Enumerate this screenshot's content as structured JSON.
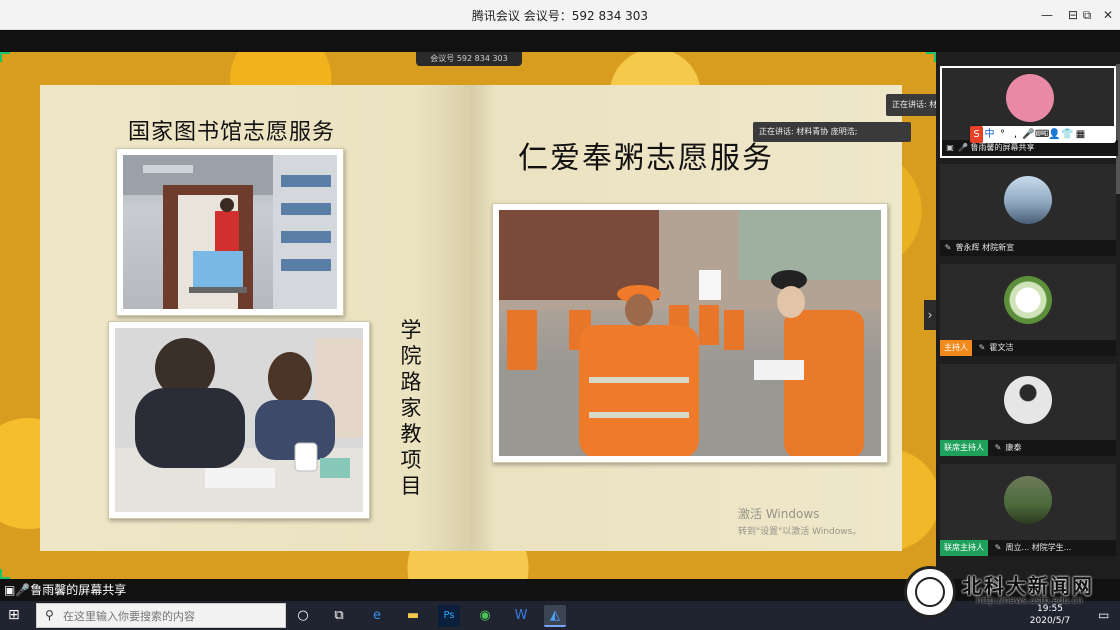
{
  "window": {
    "title": "腾讯会议 会议号：592 834 303",
    "minimize_glyph": "—",
    "maximize_glyph": "⧉",
    "close_glyph": "✕",
    "pin_glyph": "⊟"
  },
  "share": {
    "meeting_badge": "会议号 592 834 303",
    "left_title": "国家图书馆志愿服务",
    "right_title": "仁爱奉粥志愿服务",
    "vertical_text": "学院路家教项目",
    "watermark_line1": "激活 Windows",
    "watermark_line2": "转到\"设置\"以激活 Windows。",
    "nav_arrow": "›"
  },
  "speaking": {
    "tip1": "正在讲话: 材料青协 庞明浩;",
    "tip2": "正在讲话: 材料青协 庞明浩;"
  },
  "ime": {
    "items": [
      "S",
      "中",
      "°",
      ",",
      "🎤",
      "⌨",
      "👤",
      "👕",
      "▦"
    ]
  },
  "participants": [
    {
      "name": "鲁雨馨的屏幕共享",
      "role": ""
    },
    {
      "name": "曾永辉 材院新宣",
      "role": ""
    },
    {
      "name": "霍文洁",
      "role": "主持人"
    },
    {
      "name": "康泰",
      "role": "联席主持人"
    },
    {
      "name": "周立... 材院学生...",
      "role": "联席主持人"
    }
  ],
  "sharebar": {
    "label": "鲁雨馨的屏幕共享"
  },
  "taskbar": {
    "search_placeholder": "在这里输入你要搜索的内容",
    "time": "19:55",
    "date": "2020/5/7",
    "temperature": "17°C",
    "lang": "中",
    "icons": [
      "task-view",
      "edge",
      "explorer",
      "photoshop",
      "browser",
      "wps",
      "tencent-meeting"
    ]
  },
  "news": {
    "name": "北科大新闻网",
    "url": "http://news.ustb.edu.cn"
  },
  "colors": {
    "accent_green": "#19c26b",
    "host_orange": "#f08a1c",
    "cohost_green": "#1fa05b",
    "page": "#ece3c2"
  }
}
